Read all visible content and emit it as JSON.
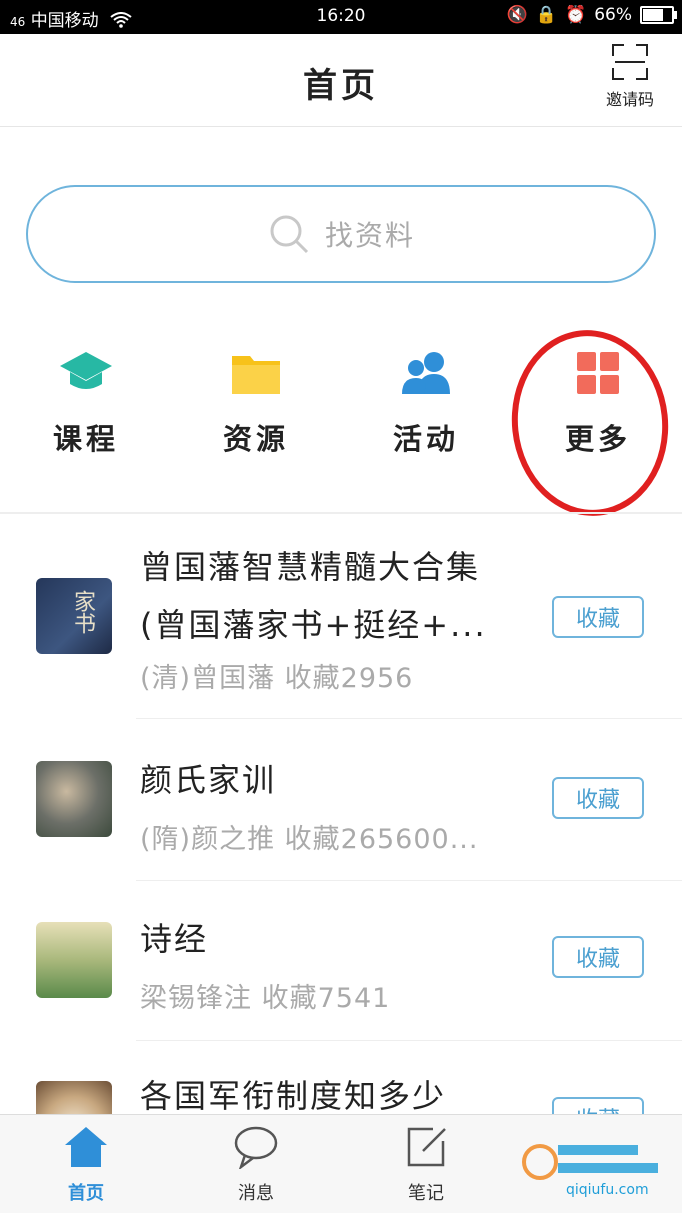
{
  "status_bar": {
    "carrier": "中国移动",
    "time": "16:20",
    "battery": "66%",
    "battery_level": 0.66
  },
  "header": {
    "title": "首页",
    "invite_label": "邀请码"
  },
  "search": {
    "placeholder": "找资料"
  },
  "quick_nav": [
    {
      "label": "课程",
      "icon": "graduation-cap-icon",
      "color": "#27b8a4"
    },
    {
      "label": "资源",
      "icon": "folder-icon",
      "color": "#f7c21a"
    },
    {
      "label": "活动",
      "icon": "users-icon",
      "color": "#2f8fd8"
    },
    {
      "label": "更多",
      "icon": "grid-icon",
      "color": "#f26b5b"
    }
  ],
  "list": [
    {
      "title_line1": "曾国藩智慧精髓大合集",
      "title_line2": "(曾国藩家书+挺经+...",
      "subtitle": "(清)曾国藩 收藏2956",
      "button": "收藏",
      "thumb_text": "家书"
    },
    {
      "title_line1": "颜氏家训",
      "subtitle": "(隋)颜之推 收藏265600...",
      "button": "收藏"
    },
    {
      "title_line1": "诗经",
      "subtitle": "梁锡锋注 收藏7541",
      "button": "收藏"
    },
    {
      "title_line1": "各国军衔制度知多少",
      "button": "收藏"
    }
  ],
  "tabbar": [
    {
      "label": "首页",
      "icon": "home-icon",
      "active": true
    },
    {
      "label": "消息",
      "icon": "chat-bubble-icon",
      "active": false
    },
    {
      "label": "笔记",
      "icon": "note-edit-icon",
      "active": false
    }
  ],
  "watermark": {
    "text": "qiqiufu.com"
  },
  "colors": {
    "accent": "#2f8fd8",
    "border_blue": "#6fb4dc",
    "annotation_red": "#e02020"
  }
}
